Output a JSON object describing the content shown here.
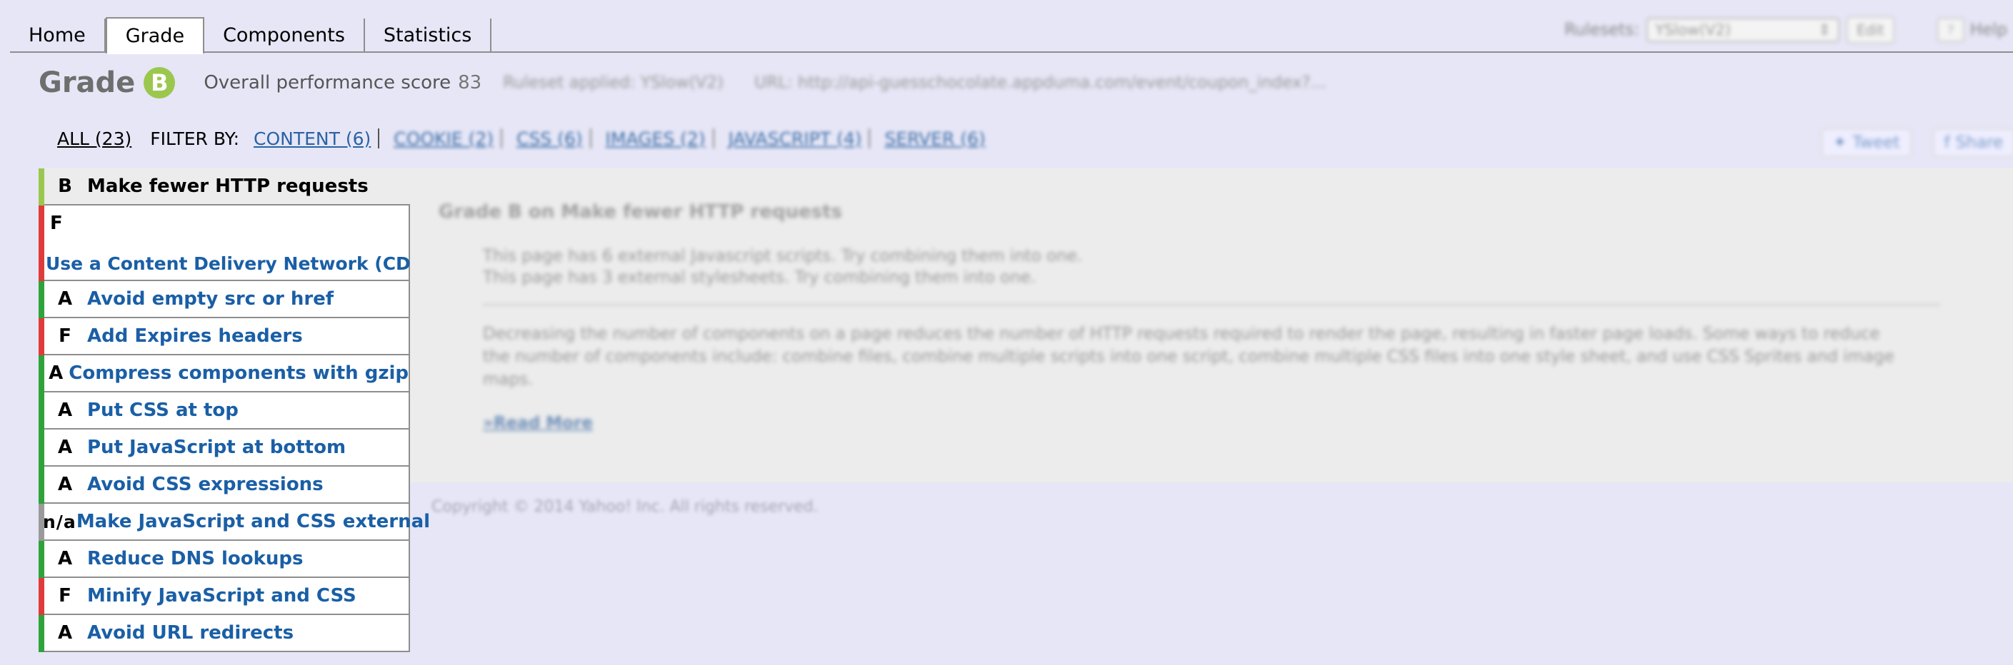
{
  "nav": {
    "tabs": [
      {
        "label": "Home"
      },
      {
        "label": "Grade"
      },
      {
        "label": "Components"
      },
      {
        "label": "Statistics"
      }
    ],
    "rulesets_label": "Rulesets:",
    "ruleset_value": "YSlow(V2)",
    "edit_label": "Edit",
    "help_label": "Help"
  },
  "grade": {
    "word": "Grade",
    "letter": "B",
    "perf_label": "Overall performance score",
    "perf_score": "83",
    "ruleset_applied": "Ruleset applied: YSlow(V2)",
    "url": "URL: http://api-guesschocolate.appduma.com/event/coupon_index?..."
  },
  "filter": {
    "all": "ALL (23)",
    "by": "FILTER BY:",
    "categories": [
      "CONTENT (6)",
      "COOKIE (2)",
      "CSS (6)",
      "IMAGES (2)",
      "JAVASCRIPT (4)",
      "SERVER (6)"
    ]
  },
  "share": {
    "tweet": "Tweet",
    "share": "Share"
  },
  "rules": [
    {
      "grade": "B",
      "title": "Make fewer HTTP requests",
      "color": "#9bc74e"
    },
    {
      "grade": "F",
      "title": "Use a Content Delivery Network (CDN)",
      "color": "#e03b3b"
    },
    {
      "grade": "A",
      "title": "Avoid empty src or href",
      "color": "#2ea33a"
    },
    {
      "grade": "F",
      "title": "Add Expires headers",
      "color": "#e03b3b"
    },
    {
      "grade": "A",
      "title": "Compress components with gzip",
      "color": "#2ea33a"
    },
    {
      "grade": "A",
      "title": "Put CSS at top",
      "color": "#2ea33a"
    },
    {
      "grade": "A",
      "title": "Put JavaScript at bottom",
      "color": "#2ea33a"
    },
    {
      "grade": "A",
      "title": "Avoid CSS expressions",
      "color": "#2ea33a"
    },
    {
      "grade": "n/a",
      "title": "Make JavaScript and CSS external",
      "color": "#9a9a9a"
    },
    {
      "grade": "A",
      "title": "Reduce DNS lookups",
      "color": "#2ea33a"
    },
    {
      "grade": "F",
      "title": "Minify JavaScript and CSS",
      "color": "#e03b3b"
    },
    {
      "grade": "A",
      "title": "Avoid URL redirects",
      "color": "#2ea33a"
    }
  ],
  "details": {
    "title": "Grade B on Make fewer HTTP requests",
    "msg1": "This page has 6 external Javascript scripts. Try combining them into one.",
    "msg2": "This page has 3 external stylesheets. Try combining them into one.",
    "desc": "Decreasing the number of components on a page reduces the number of HTTP requests required to render the page, resulting in faster page loads. Some ways to reduce the number of components include: combine files, combine multiple scripts into one script, combine multiple CSS files into one style sheet, and use CSS Sprites and image maps.",
    "read_more": "»Read More"
  },
  "copyright": "Copyright © 2014 Yahoo! Inc. All rights reserved."
}
